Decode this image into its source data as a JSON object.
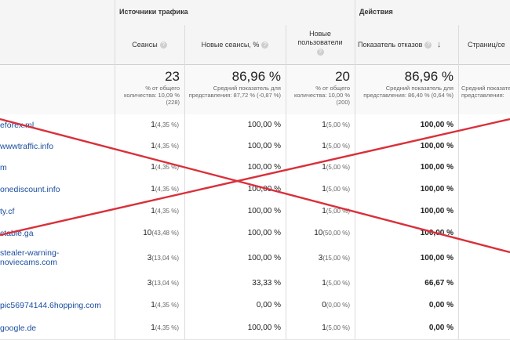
{
  "header": {
    "group_traffic": "Источники трафика",
    "group_actions": "Действия",
    "corner_q": "?",
    "col_sessions": "Сеансы",
    "col_new_sessions": "Новые сеансы, %",
    "col_new_users": "Новые пользователи",
    "col_bounce": "Показатель отказов",
    "col_pages": "Страниц/се",
    "help_glyph": "?",
    "sort_glyph": "↓"
  },
  "summary": {
    "sessions": {
      "big": "23",
      "small": "% от общего количества: 10,09 % (228)"
    },
    "new_sessions": {
      "big": "86,96 %",
      "small": "Средний показатель для представления: 87,72 % (-0,87 %)"
    },
    "new_users": {
      "big": "20",
      "small": "% от общего количества: 10,00 % (200)"
    },
    "bounce": {
      "big": "86,96 %",
      "small": "Средний показатель для представления: 86,40 % (0,64 %)"
    },
    "pages": {
      "small": "Средний показатель для представления:"
    }
  },
  "rows": [
    {
      "source": "eforex.ml",
      "sessions": "1",
      "sessions_pct": "(4,35 %)",
      "new_sessions": "100,00 %",
      "new_users": "1",
      "new_users_pct": "(5,00 %)",
      "bounce": "100,00 %"
    },
    {
      "source": "wwwtraffic.info",
      "sessions": "1",
      "sessions_pct": "(4,35 %)",
      "new_sessions": "100,00 %",
      "new_users": "1",
      "new_users_pct": "(5,00 %)",
      "bounce": "100,00 %"
    },
    {
      "source": "m",
      "sessions": "1",
      "sessions_pct": "(4,35 %)",
      "new_sessions": "100,00 %",
      "new_users": "1",
      "new_users_pct": "(5,00 %)",
      "bounce": "100,00 %"
    },
    {
      "source": "onediscount.info",
      "sessions": "1",
      "sessions_pct": "(4,35 %)",
      "new_sessions": "100,00 %",
      "new_users": "1",
      "new_users_pct": "(5,00 %)",
      "bounce": "100,00 %"
    },
    {
      "source": "ty.cf",
      "sessions": "1",
      "sessions_pct": "(4,35 %)",
      "new_sessions": "100,00 %",
      "new_users": "1",
      "new_users_pct": "(5,00 %)",
      "bounce": "100,00 %"
    },
    {
      "source": "ctable.ga",
      "sessions": "10",
      "sessions_pct": "(43,48 %)",
      "new_sessions": "100,00 %",
      "new_users": "10",
      "new_users_pct": "(50,00 %)",
      "bounce": "100,00 %"
    },
    {
      "source": "stealer-warning-\nnoviecams.com",
      "sessions": "3",
      "sessions_pct": "(13,04 %)",
      "new_sessions": "100,00 %",
      "new_users": "3",
      "new_users_pct": "(15,00 %)",
      "bounce": "100,00 %"
    },
    {
      "source": "",
      "sessions": "3",
      "sessions_pct": "(13,04 %)",
      "new_sessions": "33,33 %",
      "new_users": "1",
      "new_users_pct": "(5,00 %)",
      "bounce": "66,67 %"
    },
    {
      "source": "pic56974144.6hopping.com",
      "sessions": "1",
      "sessions_pct": "(4,35 %)",
      "new_sessions": "0,00 %",
      "new_users": "0",
      "new_users_pct": "(0,00 %)",
      "bounce": "0,00 %"
    },
    {
      "source": "google.de",
      "sessions": "1",
      "sessions_pct": "(4,35 %)",
      "new_sessions": "100,00 %",
      "new_users": "1",
      "new_users_pct": "(5,00 %)",
      "bounce": "0,00 %"
    }
  ],
  "colors": {
    "link": "#1a4e9e",
    "cross": "#d9303a",
    "header_bg": "#f5f5f5"
  }
}
